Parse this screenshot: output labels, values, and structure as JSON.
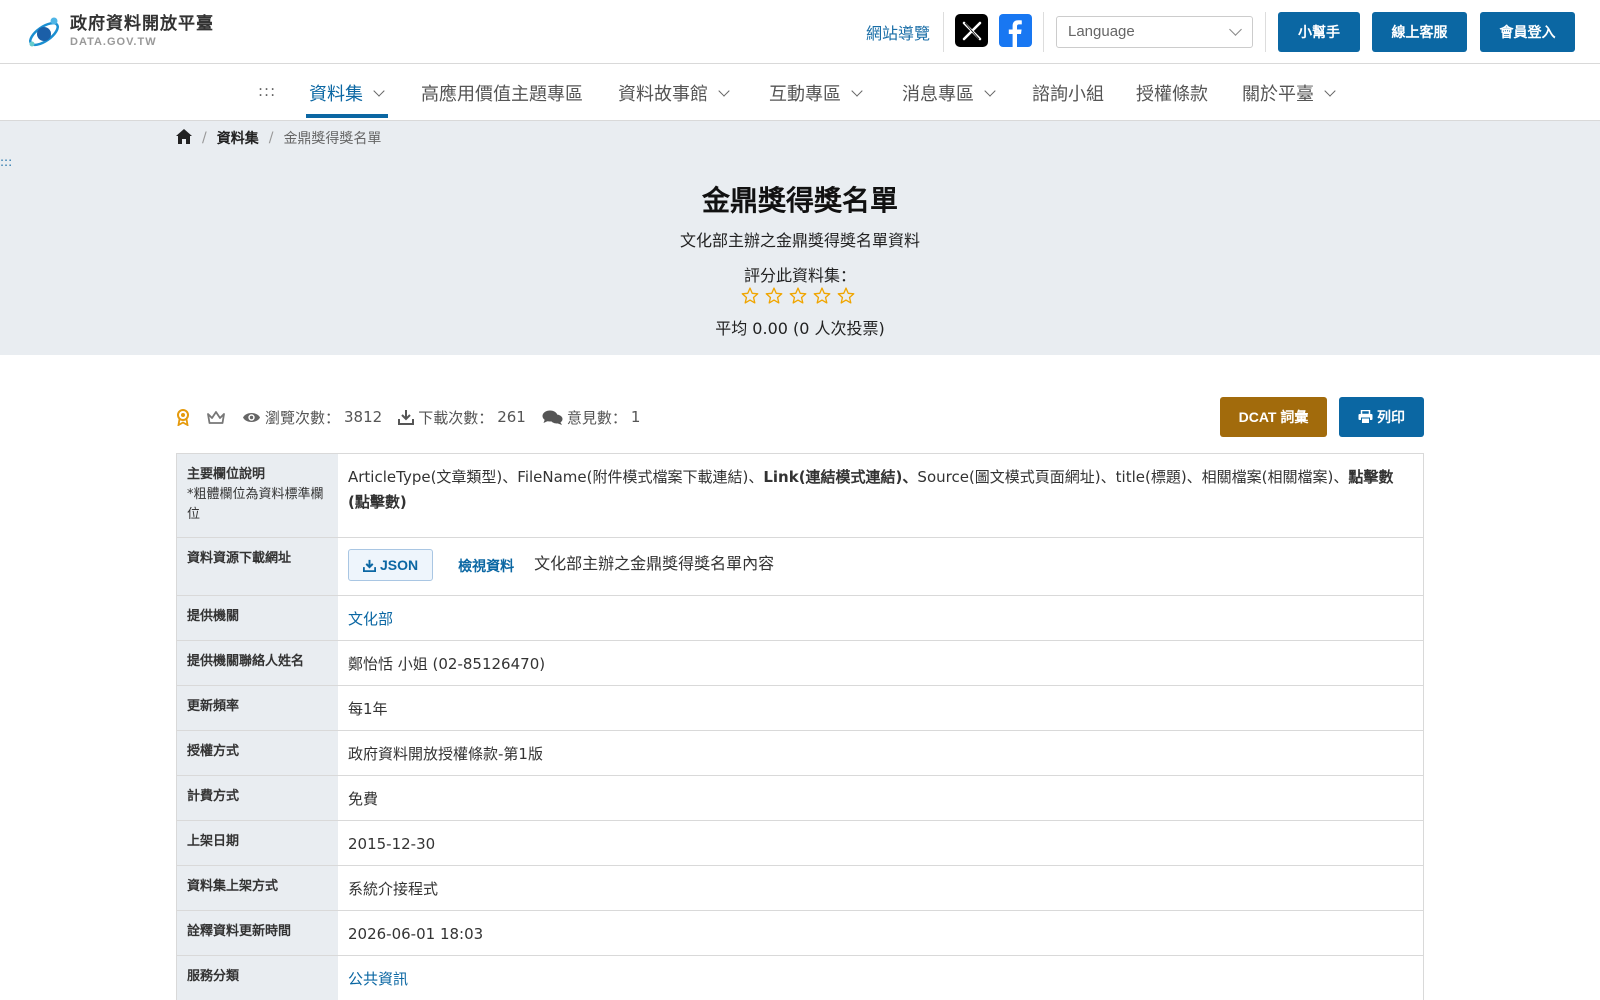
{
  "header": {
    "logo_title": "政府資料開放平臺",
    "logo_sub": "DATA.GOV.TW",
    "sitemap_label": "網站導覽",
    "language_placeholder": "Language",
    "help_button": "小幫手",
    "service_button": "線上客服",
    "login_button": "會員登入"
  },
  "nav": {
    "accesskey": ":::",
    "items": [
      {
        "label": "資料集",
        "dropdown": true,
        "active": true
      },
      {
        "label": "高應用價值主題專區",
        "dropdown": false
      },
      {
        "label": "資料故事館",
        "dropdown": true
      },
      {
        "label": "互動專區",
        "dropdown": true
      },
      {
        "label": "消息專區",
        "dropdown": true
      },
      {
        "label": "諮詢小組",
        "dropdown": false
      },
      {
        "label": "授權條款",
        "dropdown": false
      },
      {
        "label": "關於平臺",
        "dropdown": true
      }
    ]
  },
  "breadcrumb": {
    "home_icon": "home-icon",
    "level1": "資料集",
    "current": "金鼎獎得獎名單",
    "separator": "/"
  },
  "side_accesskey": ":::",
  "dataset": {
    "title": "金鼎獎得獎名單",
    "description": "文化部主辦之金鼎獎得獎名單資料",
    "rating_label": "評分此資料集：",
    "rating_stars": 5,
    "rating_value": 0,
    "average_text": "平均 0.00 (0 人次投票)"
  },
  "stats": {
    "views_label": "瀏覽次數：",
    "views_value": "3812",
    "downloads_label": "下載次數：",
    "downloads_value": "261",
    "comments_label": "意見數：",
    "comments_value": "1"
  },
  "actions": {
    "dcat_label": "DCAT 詞彙",
    "print_label": "列印"
  },
  "table": {
    "fields_label": "主要欄位說明",
    "fields_note": "*粗體欄位為資料標準欄位",
    "fields_parts": [
      {
        "text": "ArticleType(文章類型)、FileName(附件模式檔案下載連結)、",
        "bold": false
      },
      {
        "text": "Link(連結模式連結)、",
        "bold": true
      },
      {
        "text": "Source(圖文模式頁面網址)、title(標題)、相關檔案(相關檔案)、",
        "bold": false
      },
      {
        "text": "點擊數(點擊數)",
        "bold": true
      }
    ],
    "download_label": "資料資源下載網址",
    "json_button": "JSON",
    "view_data_label": "檢視資料",
    "resource_desc": "文化部主辦之金鼎獎得獎名單內容",
    "provider_label": "提供機關",
    "provider_value": "文化部",
    "contact_label": "提供機關聯絡人姓名",
    "contact_value": "鄭怡恬 小姐 (02-85126470)",
    "frequency_label": "更新頻率",
    "frequency_value": "每1年",
    "license_label": "授權方式",
    "license_value": "政府資料開放授權條款-第1版",
    "fee_label": "計費方式",
    "fee_value": "免費",
    "publish_label": "上架日期",
    "publish_value": "2015-12-30",
    "method_label": "資料集上架方式",
    "method_value": "系統介接程式",
    "meta_updated_label": "詮釋資料更新時間",
    "meta_updated_value": "2026-06-01 18:03",
    "category_label": "服務分類",
    "category_value": "公共資訊"
  },
  "colors": {
    "primary": "#0b67a3",
    "dcat": "#a26b0c",
    "hero_bg": "#e9edf1",
    "star": "#f0a500",
    "badge": "#e59a0c"
  }
}
